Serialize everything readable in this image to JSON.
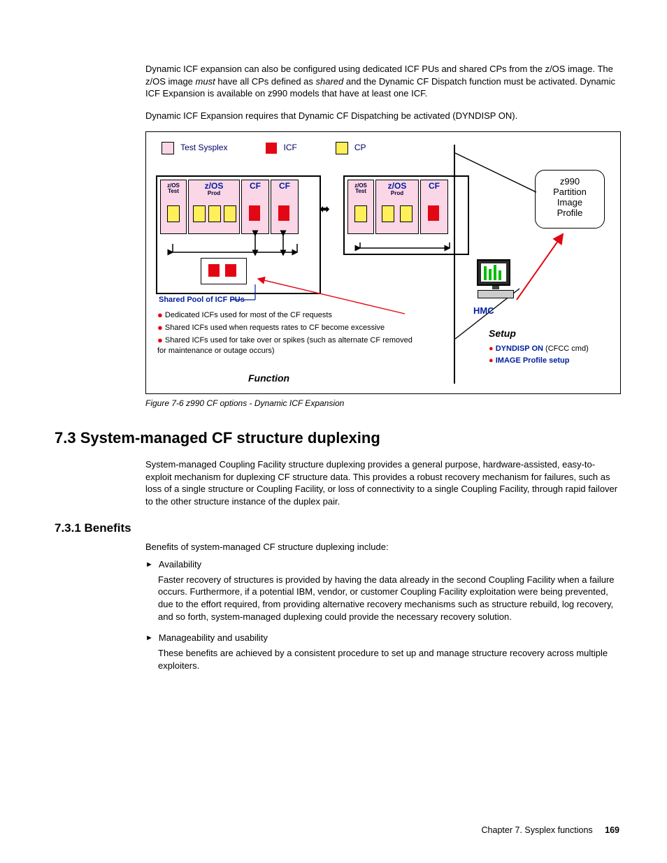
{
  "para1_a": "Dynamic ICF expansion can also be configured using dedicated ICF PUs and shared CPs from the z/OS image. The z/OS image ",
  "para1_must": "must",
  "para1_b": " have all CPs defined as ",
  "para1_shared": "shared",
  "para1_c": " and the Dynamic CF Dispatch function must be activated. Dynamic ICF Expansion is available on z990 models that have at least one ICF.",
  "para2": "Dynamic ICF Expansion requires that Dynamic CF Dispatching be activated (DYNDISP ON).",
  "figcaption": "Figure 7-6   z990 CF options - Dynamic ICF Expansion",
  "h2": "7.3  System-managed CF structure duplexing",
  "para3": "System-managed Coupling Facility structure duplexing provides a general purpose, hardware-assisted, easy-to-exploit mechanism for duplexing CF structure data. This provides a robust recovery mechanism for failures, such as loss of a single structure or Coupling Facility, or loss of connectivity to a single Coupling Facility, through rapid failover to the other structure instance of the duplex pair.",
  "h3": "7.3.1  Benefits",
  "benIntro": "Benefits of system-managed CF structure duplexing include:",
  "b1": "Availability",
  "b1body": "Faster recovery of structures is provided by having the data already in the second Coupling Facility when a failure occurs. Furthermore, if a potential IBM, vendor, or customer Coupling Facility exploitation were being prevented, due to the effort required, from providing alternative recovery mechanisms such as structure rebuild, log recovery, and so forth, system-managed duplexing could provide the necessary recovery solution.",
  "b2": "Manageability and usability",
  "b2body": "These benefits are achieved by a consistent procedure to set up and manage structure recovery across multiple exploiters.",
  "footerChap": "Chapter 7. Sysplex functions",
  "footerPg": "169",
  "diagram": {
    "legend": {
      "testSysplex": "Test Sysplex",
      "icf": "ICF",
      "cp": "CP"
    },
    "zosTest": "z/OS\nTest",
    "zosProd": "z/OS",
    "prod": "Prod",
    "cf": "CF",
    "sharedPool": "Shared Pool of ICF PUs",
    "note1": "Dedicated ICFs used for most of the CF requests",
    "note2": "Shared ICFs used when requests rates to CF become excessive",
    "note3": "Shared ICFs used for take over or spikes (such as alternate CF removed for maintenance or outage occurs)",
    "function": "Function",
    "profile": "z990\nPartition\nImage\nProfile",
    "hmc": "HMC",
    "setup": "Setup",
    "dyndisp": "DYNDISP ON",
    "cfcc": " (CFCC cmd)",
    "imageprof": "IMAGE Profile setup"
  }
}
